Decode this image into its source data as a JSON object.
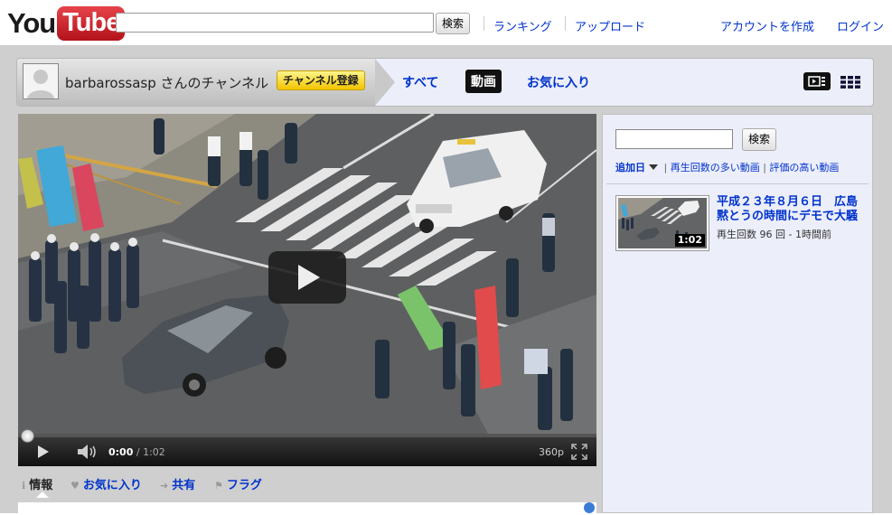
{
  "header": {
    "logo_you": "You",
    "logo_tube": "Tube",
    "search_button": "検索",
    "nav": [
      "ランキング",
      "アップロード"
    ],
    "account": [
      "アカウントを作成",
      "ログイン"
    ]
  },
  "channel": {
    "name": "barbarossasp さんのチャンネル",
    "subscribe": "チャンネル登録",
    "tabs": [
      "すべて",
      "動画",
      "お気に入り"
    ]
  },
  "player": {
    "current_time": "0:00",
    "total_time": "1:02",
    "time_separator": " / ",
    "quality": "360p",
    "progress": 0.0
  },
  "info_tabs": [
    "情報",
    "お気に入り",
    "共有",
    "フラグ"
  ],
  "sidebar": {
    "search_button": "検索",
    "sort": {
      "active": "追加日",
      "others": [
        "再生回数の多い動画",
        "評価の高い動画"
      ],
      "separator": " | "
    },
    "videos": [
      {
        "title": "平成２３年８月６日　広島黙とうの時間にデモで大騒",
        "views": "再生回数 96 回 - 1時間前",
        "duration": "1:02"
      }
    ]
  },
  "colors": {
    "link": "#0033cc",
    "subscribe_bg": "#f7d417",
    "logo_red": "#cc181e",
    "channel_bg": "#eceefa",
    "page_gray": "#cfcfcf"
  }
}
